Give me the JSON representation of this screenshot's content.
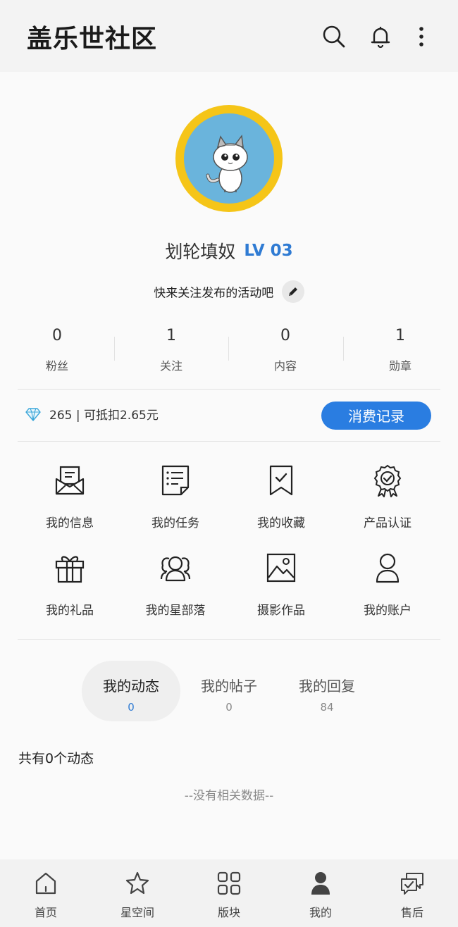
{
  "header": {
    "title": "盖乐世社区",
    "icons": [
      "search-icon",
      "bell-icon",
      "more-vertical-icon"
    ]
  },
  "profile": {
    "username": "划轮填奴",
    "level": "LV 03",
    "bio": "快来关注发布的活动吧",
    "avatar": "cat-avatar",
    "ring_color": "#f5c518"
  },
  "stats": [
    {
      "value": "0",
      "label": "粉丝"
    },
    {
      "value": "1",
      "label": "关注"
    },
    {
      "value": "0",
      "label": "内容"
    },
    {
      "value": "1",
      "label": "勋章"
    }
  ],
  "points": {
    "text": "265 | 可抵扣2.65元",
    "button_label": "消费记录",
    "accent": "#2a7de1"
  },
  "grid": [
    {
      "label": "我的信息",
      "icon": "message-envelope-icon"
    },
    {
      "label": "我的任务",
      "icon": "task-list-icon"
    },
    {
      "label": "我的收藏",
      "icon": "bookmark-check-icon"
    },
    {
      "label": "产品认证",
      "icon": "certified-badge-icon"
    },
    {
      "label": "我的礼品",
      "icon": "gift-icon"
    },
    {
      "label": "我的星部落",
      "icon": "group-icon"
    },
    {
      "label": "摄影作品",
      "icon": "image-icon"
    },
    {
      "label": "我的账户",
      "icon": "user-icon"
    }
  ],
  "tabs": [
    {
      "label": "我的动态",
      "count": "0",
      "active": true
    },
    {
      "label": "我的帖子",
      "count": "0",
      "active": false
    },
    {
      "label": "我的回复",
      "count": "84",
      "active": false
    }
  ],
  "feed": {
    "count_text": "共有0个动态",
    "empty_text": "--没有相关数据--"
  },
  "bottom_nav": [
    {
      "label": "首页",
      "icon": "home-icon"
    },
    {
      "label": "星空间",
      "icon": "star-icon"
    },
    {
      "label": "版块",
      "icon": "grid-icon"
    },
    {
      "label": "我的",
      "icon": "person-filled-icon",
      "active": true
    },
    {
      "label": "售后",
      "icon": "chat-check-icon"
    }
  ]
}
